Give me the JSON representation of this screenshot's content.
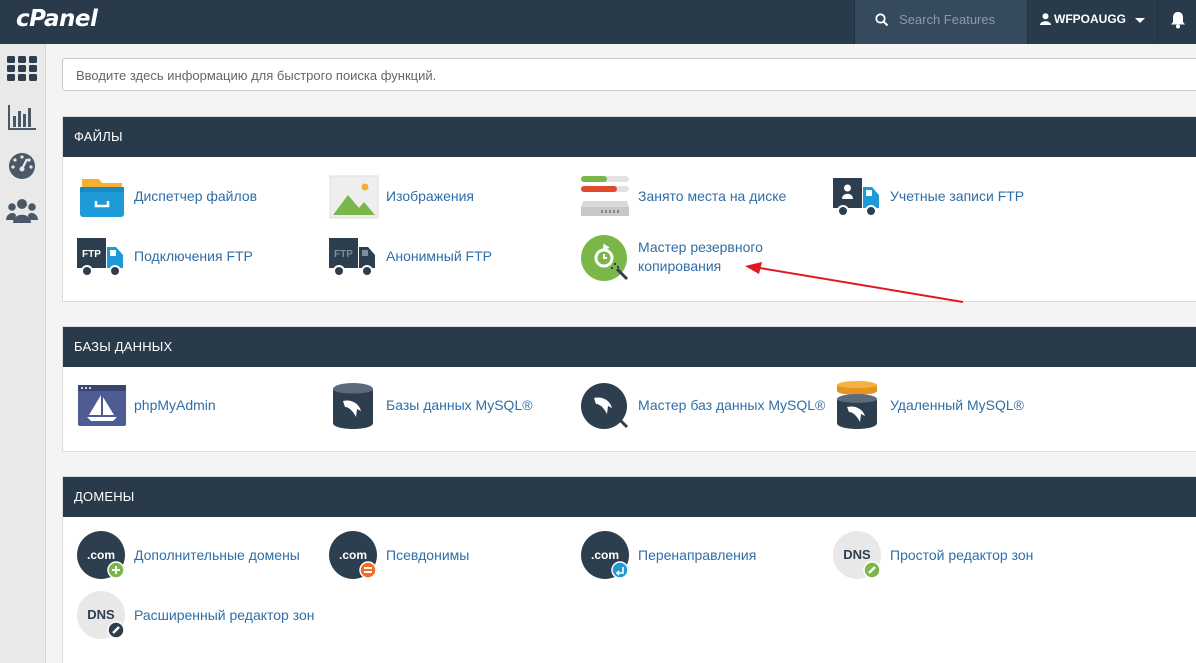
{
  "topbar": {
    "logo": "cPanel",
    "search_placeholder": "Search Features",
    "username": "WFPOAUGG"
  },
  "sidebar": {
    "items": [
      "home-grid-icon",
      "stats-icon",
      "dashboard-icon",
      "users-icon"
    ]
  },
  "quick_search": {
    "placeholder": "Вводите здесь информацию для быстрого поиска функций."
  },
  "sections": {
    "files": {
      "title": "ФАЙЛЫ",
      "items": [
        "Диспетчер файлов",
        "Изображения",
        "Занято места на диске",
        "Учетные записи FTP",
        "Подключения FTP",
        "Анонимный FTP",
        "Мастер резервного копирования"
      ],
      "backup_line1": "Мастер резервного",
      "backup_line2": "копирования"
    },
    "databases": {
      "title": "БАЗЫ ДАННЫХ",
      "items": [
        "phpMyAdmin",
        "Базы данных MySQL®",
        "Мастер баз данных MySQL®",
        "Удаленный MySQL®"
      ]
    },
    "domains": {
      "title": "ДОМЕНЫ",
      "items": [
        "Дополнительные домены",
        "Псевдонимы",
        "Перенаправления",
        "Простой редактор зон",
        "Расширенный редактор зон"
      ]
    }
  },
  "icon_text": {
    "com": ".com",
    "dns": "DNS",
    "ftp": "FTP"
  },
  "colors": {
    "topbar": "#293a4a",
    "link": "#2f6ea6",
    "annotation_arrow": "#e0191f"
  }
}
